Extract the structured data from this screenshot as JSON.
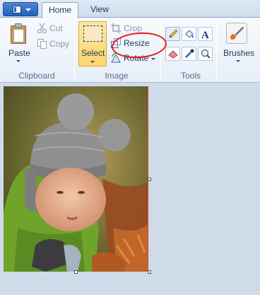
{
  "tabs": {
    "home": "Home",
    "view": "View"
  },
  "clipboard": {
    "paste": "Paste",
    "cut": "Cut",
    "copy": "Copy",
    "group": "Clipboard"
  },
  "image": {
    "select": "Select",
    "crop": "Crop",
    "resize": "Resize",
    "rotate": "Rotate",
    "group": "Image"
  },
  "tools": {
    "group": "Tools",
    "items": [
      "pencil-icon",
      "fill-bucket-icon",
      "text-icon",
      "eraser-icon",
      "color-picker-icon",
      "magnifier-icon"
    ]
  },
  "brushes": {
    "label": "Brushes"
  },
  "colors": {
    "accent": "#2a63b0",
    "annotation": "#e11b1b",
    "select_bg": "#ffd46c"
  }
}
